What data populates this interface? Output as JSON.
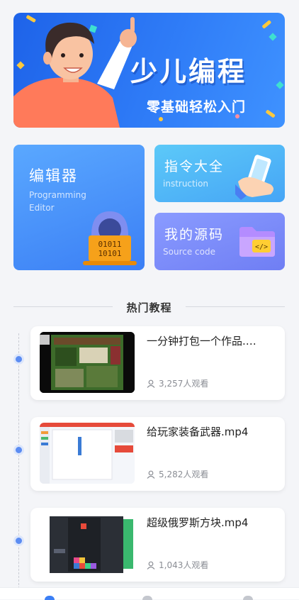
{
  "banner": {
    "title": "少儿编程",
    "subtitle": "零基础轻松入门"
  },
  "features": {
    "editor": {
      "title": "编辑器",
      "subtitle_line1": "Programming",
      "subtitle_line2": "Editor"
    },
    "instruction": {
      "title": "指令大全",
      "subtitle": "instruction"
    },
    "source": {
      "title": "我的源码",
      "subtitle": "Source code"
    }
  },
  "section": {
    "title": "热门教程"
  },
  "tutorials": [
    {
      "name": "一分钟打包一个作品.…",
      "views": "3,257人观看",
      "thumb": "game-screenshot"
    },
    {
      "name": "给玩家装备武器.mp4",
      "views": "5,282人观看",
      "thumb": "editor-screenshot"
    },
    {
      "name": "超级俄罗斯方块.mp4",
      "views": "1,043人观看",
      "thumb": "tetris-screenshot"
    }
  ],
  "tabbar": {
    "items": [
      "home-icon",
      "course-icon",
      "profile-icon"
    ]
  },
  "colors": {
    "primary": "#2f7cf7",
    "accent": "#5b8cf2"
  }
}
